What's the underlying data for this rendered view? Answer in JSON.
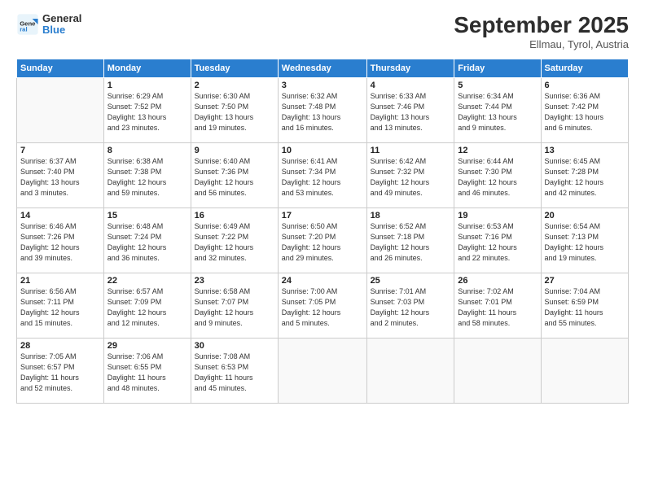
{
  "header": {
    "logo_general": "General",
    "logo_blue": "Blue",
    "month_title": "September 2025",
    "location": "Ellmau, Tyrol, Austria"
  },
  "days_of_week": [
    "Sunday",
    "Monday",
    "Tuesday",
    "Wednesday",
    "Thursday",
    "Friday",
    "Saturday"
  ],
  "weeks": [
    [
      {
        "day": "",
        "info": ""
      },
      {
        "day": "1",
        "info": "Sunrise: 6:29 AM\nSunset: 7:52 PM\nDaylight: 13 hours\nand 23 minutes."
      },
      {
        "day": "2",
        "info": "Sunrise: 6:30 AM\nSunset: 7:50 PM\nDaylight: 13 hours\nand 19 minutes."
      },
      {
        "day": "3",
        "info": "Sunrise: 6:32 AM\nSunset: 7:48 PM\nDaylight: 13 hours\nand 16 minutes."
      },
      {
        "day": "4",
        "info": "Sunrise: 6:33 AM\nSunset: 7:46 PM\nDaylight: 13 hours\nand 13 minutes."
      },
      {
        "day": "5",
        "info": "Sunrise: 6:34 AM\nSunset: 7:44 PM\nDaylight: 13 hours\nand 9 minutes."
      },
      {
        "day": "6",
        "info": "Sunrise: 6:36 AM\nSunset: 7:42 PM\nDaylight: 13 hours\nand 6 minutes."
      }
    ],
    [
      {
        "day": "7",
        "info": "Sunrise: 6:37 AM\nSunset: 7:40 PM\nDaylight: 13 hours\nand 3 minutes."
      },
      {
        "day": "8",
        "info": "Sunrise: 6:38 AM\nSunset: 7:38 PM\nDaylight: 12 hours\nand 59 minutes."
      },
      {
        "day": "9",
        "info": "Sunrise: 6:40 AM\nSunset: 7:36 PM\nDaylight: 12 hours\nand 56 minutes."
      },
      {
        "day": "10",
        "info": "Sunrise: 6:41 AM\nSunset: 7:34 PM\nDaylight: 12 hours\nand 53 minutes."
      },
      {
        "day": "11",
        "info": "Sunrise: 6:42 AM\nSunset: 7:32 PM\nDaylight: 12 hours\nand 49 minutes."
      },
      {
        "day": "12",
        "info": "Sunrise: 6:44 AM\nSunset: 7:30 PM\nDaylight: 12 hours\nand 46 minutes."
      },
      {
        "day": "13",
        "info": "Sunrise: 6:45 AM\nSunset: 7:28 PM\nDaylight: 12 hours\nand 42 minutes."
      }
    ],
    [
      {
        "day": "14",
        "info": "Sunrise: 6:46 AM\nSunset: 7:26 PM\nDaylight: 12 hours\nand 39 minutes."
      },
      {
        "day": "15",
        "info": "Sunrise: 6:48 AM\nSunset: 7:24 PM\nDaylight: 12 hours\nand 36 minutes."
      },
      {
        "day": "16",
        "info": "Sunrise: 6:49 AM\nSunset: 7:22 PM\nDaylight: 12 hours\nand 32 minutes."
      },
      {
        "day": "17",
        "info": "Sunrise: 6:50 AM\nSunset: 7:20 PM\nDaylight: 12 hours\nand 29 minutes."
      },
      {
        "day": "18",
        "info": "Sunrise: 6:52 AM\nSunset: 7:18 PM\nDaylight: 12 hours\nand 26 minutes."
      },
      {
        "day": "19",
        "info": "Sunrise: 6:53 AM\nSunset: 7:16 PM\nDaylight: 12 hours\nand 22 minutes."
      },
      {
        "day": "20",
        "info": "Sunrise: 6:54 AM\nSunset: 7:13 PM\nDaylight: 12 hours\nand 19 minutes."
      }
    ],
    [
      {
        "day": "21",
        "info": "Sunrise: 6:56 AM\nSunset: 7:11 PM\nDaylight: 12 hours\nand 15 minutes."
      },
      {
        "day": "22",
        "info": "Sunrise: 6:57 AM\nSunset: 7:09 PM\nDaylight: 12 hours\nand 12 minutes."
      },
      {
        "day": "23",
        "info": "Sunrise: 6:58 AM\nSunset: 7:07 PM\nDaylight: 12 hours\nand 9 minutes."
      },
      {
        "day": "24",
        "info": "Sunrise: 7:00 AM\nSunset: 7:05 PM\nDaylight: 12 hours\nand 5 minutes."
      },
      {
        "day": "25",
        "info": "Sunrise: 7:01 AM\nSunset: 7:03 PM\nDaylight: 12 hours\nand 2 minutes."
      },
      {
        "day": "26",
        "info": "Sunrise: 7:02 AM\nSunset: 7:01 PM\nDaylight: 11 hours\nand 58 minutes."
      },
      {
        "day": "27",
        "info": "Sunrise: 7:04 AM\nSunset: 6:59 PM\nDaylight: 11 hours\nand 55 minutes."
      }
    ],
    [
      {
        "day": "28",
        "info": "Sunrise: 7:05 AM\nSunset: 6:57 PM\nDaylight: 11 hours\nand 52 minutes."
      },
      {
        "day": "29",
        "info": "Sunrise: 7:06 AM\nSunset: 6:55 PM\nDaylight: 11 hours\nand 48 minutes."
      },
      {
        "day": "30",
        "info": "Sunrise: 7:08 AM\nSunset: 6:53 PM\nDaylight: 11 hours\nand 45 minutes."
      },
      {
        "day": "",
        "info": ""
      },
      {
        "day": "",
        "info": ""
      },
      {
        "day": "",
        "info": ""
      },
      {
        "day": "",
        "info": ""
      }
    ]
  ]
}
